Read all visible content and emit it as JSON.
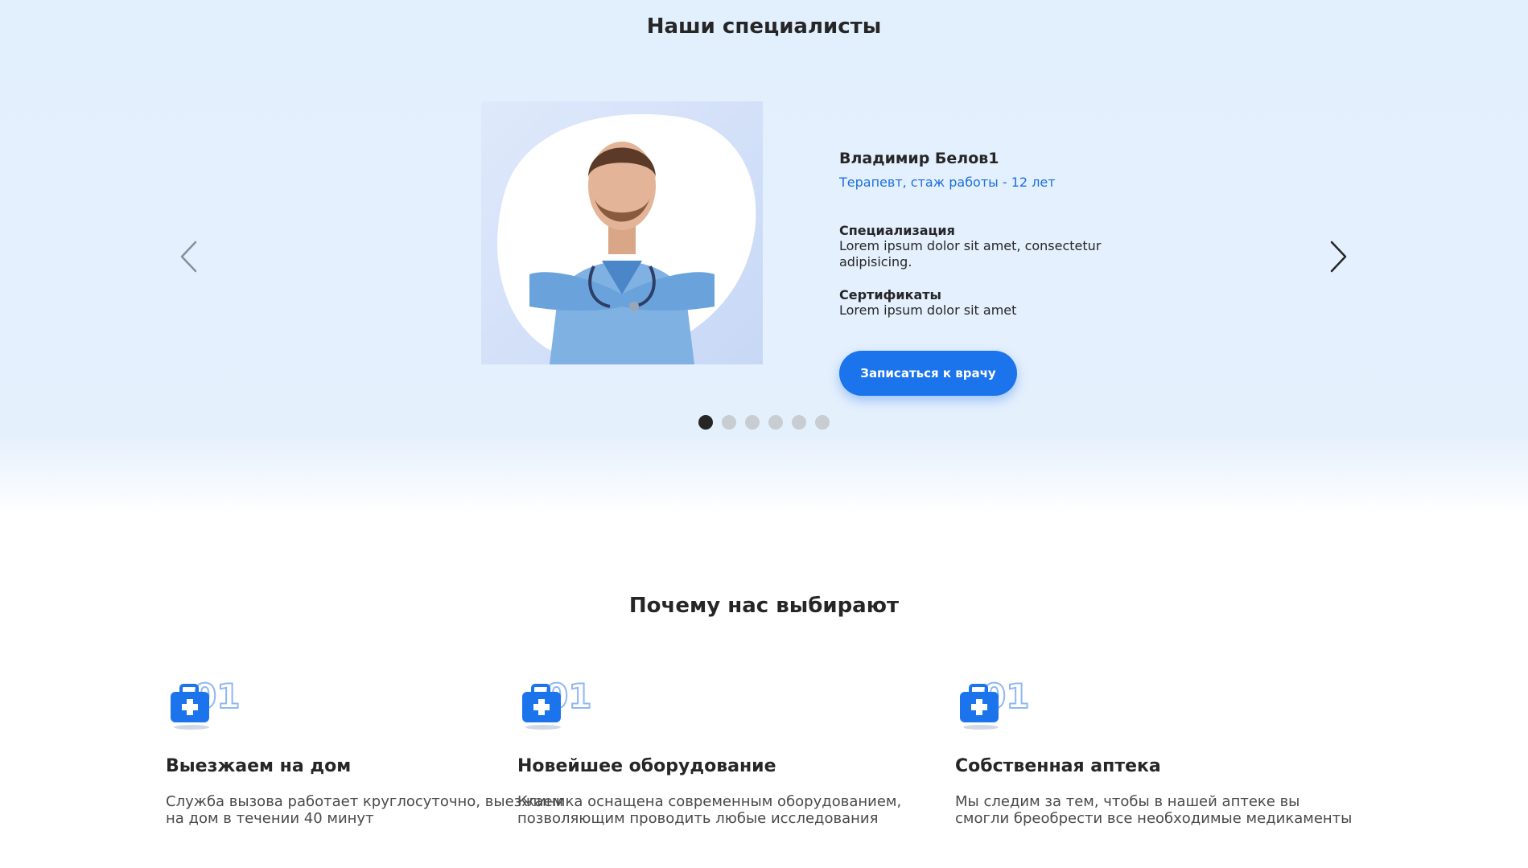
{
  "specialists": {
    "title": "Наши специалисты",
    "doctor": {
      "name": "Владимир Белов1",
      "role": "Терапевт, стаж работы - 12 лет",
      "specialization_label": "Специализация",
      "specialization_text": "Lorem ipsum dolor sit amet, consectetur adipisicing.",
      "certificates_label": "Сертификаты",
      "certificates_text": "Lorem ipsum dolor sit amet"
    },
    "book_button": "Записаться к врачу",
    "slides_total": 6,
    "active_slide": 1,
    "prev_icon": "chevron-left-icon",
    "next_icon": "chevron-right-icon"
  },
  "why_us": {
    "title": "Почему нас выбирают",
    "features": [
      {
        "number": "01",
        "icon": "medical-kit-icon",
        "title": "Выезжаем на дом",
        "text": "Служба вызова работает круглосуточно, выезжаем на дом в течении 40 минут"
      },
      {
        "number": "01",
        "icon": "medical-kit-icon",
        "title": "Новейшее оборудование",
        "text": "Клиника оснащена современным оборудованием, позволяющим проводить любые исследования"
      },
      {
        "number": "01",
        "icon": "medical-kit-icon",
        "title": "Собственная аптека",
        "text": "Мы следим за тем, чтобы в нашей аптеке вы смогли бреобрести все необходимые медикаменты"
      }
    ]
  },
  "colors": {
    "accent": "#1b74ec",
    "role_text": "#1f6fe0",
    "hero_bg": "#e3effd",
    "dot_active": "#262626",
    "dot_inactive": "#c8ccd3"
  }
}
